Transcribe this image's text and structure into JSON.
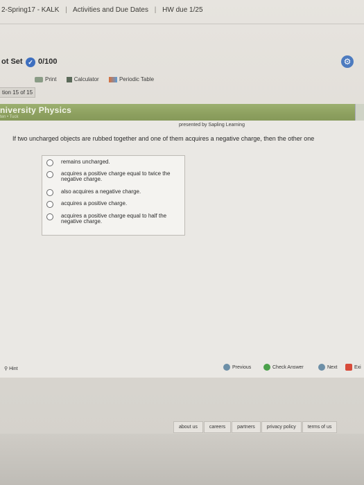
{
  "breadcrumb": {
    "items": [
      "2-Spring17 - KALK",
      "Activities and Due Dates",
      "HW due 1/25"
    ],
    "separator": "|"
  },
  "assignment": {
    "title": "ot Set",
    "score": "0/100",
    "tools": [
      "Print",
      "Calculator",
      "Periodic Table"
    ],
    "question_position": "tion 15 of 15"
  },
  "question_panel": {
    "course": "niversity Physics",
    "author": "ten • Tuck",
    "presented_by": "presented by Sapling Learning",
    "question_text": "If two uncharged objects are rubbed together and one of them acquires a negative charge, then the other one",
    "choices": [
      "remains uncharged.",
      "acquires a positive charge equal to twice the negative charge.",
      "also acquires a negative charge.",
      "acquires a positive charge.",
      "acquires a positive charge equal to half the negative charge."
    ]
  },
  "footer_nav": {
    "hint": "Hint",
    "previous": "Previous",
    "check_answer": "Check Answer",
    "next": "Next",
    "exit": "Exi"
  },
  "footer_links": [
    "about us",
    "careers",
    "partners",
    "privacy policy",
    "terms of us"
  ],
  "colors": {
    "header_green": "#8da05f",
    "accent_blue": "#3e6fbf",
    "check_green": "#4aa04a",
    "exit_red": "#d84b3a"
  }
}
